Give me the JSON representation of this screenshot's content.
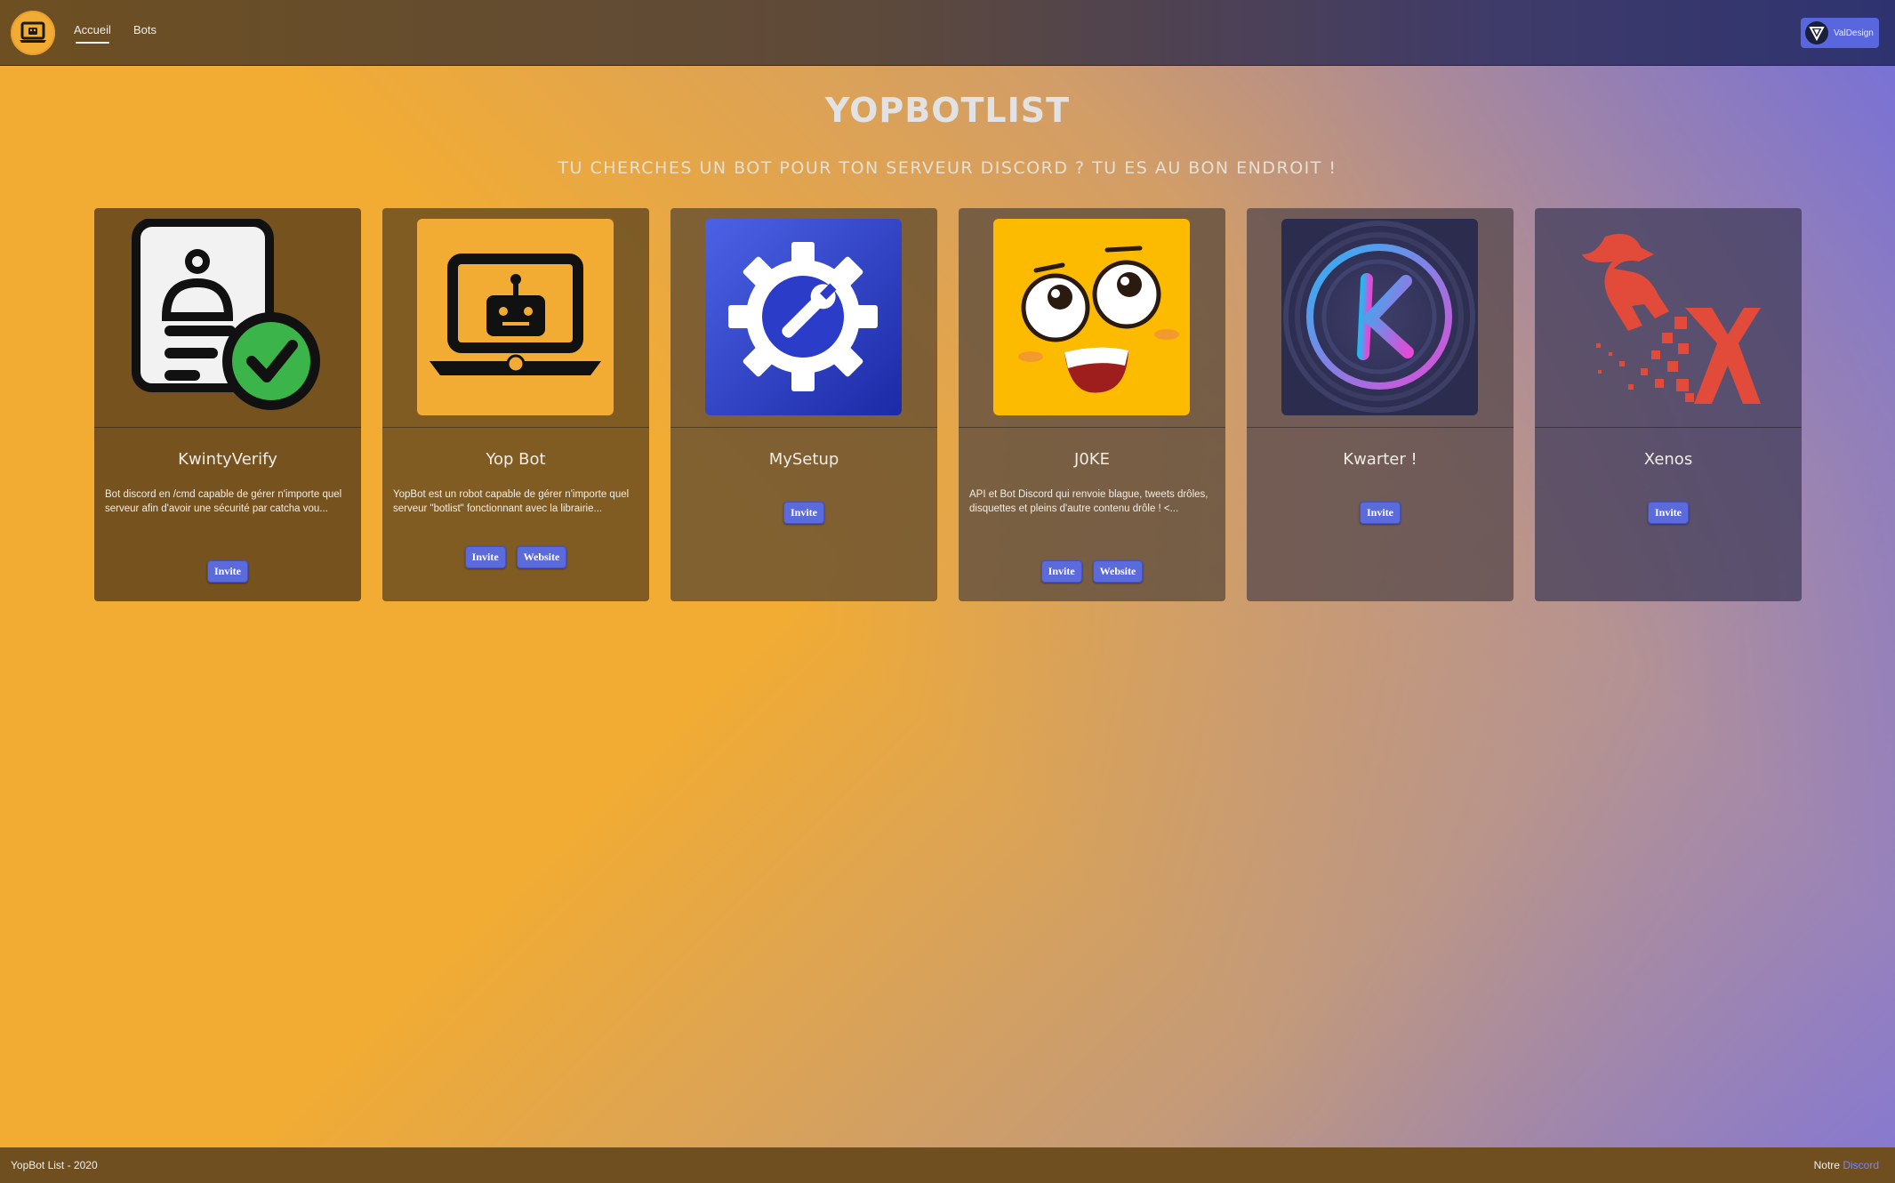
{
  "nav": {
    "links": [
      {
        "label": "Accueil",
        "active": true
      },
      {
        "label": "Bots",
        "active": false
      }
    ],
    "user_name": "ValDesign"
  },
  "hero": {
    "title": "YOPBOTLIST",
    "subtitle": "TU CHERCHES UN BOT POUR TON SERVEUR DISCORD ? TU ES AU BON ENDROIT !"
  },
  "bots": [
    {
      "name": "KwintyVerify",
      "icon": "id-card-check-icon",
      "description": "Bot discord en /cmd capable de gérer n'importe quel serveur afin d'avoir une sécurité par catcha vou...",
      "buttons": [
        "Invite"
      ],
      "card_color": "#6f4e1f"
    },
    {
      "name": "Yop Bot",
      "icon": "robot-laptop-icon",
      "description": "YopBot est un robot capable de gérer n'importe quel serveur \"botlist\" fonctionnant avec la librairie...",
      "buttons": [
        "Invite",
        "Website"
      ],
      "card_color": "#6c4e21"
    },
    {
      "name": "MySetup",
      "icon": "gear-wrench-icon",
      "description": "",
      "buttons": [
        "Invite"
      ],
      "card_color": "#5e4a3a"
    },
    {
      "name": "J0KE",
      "icon": "funny-face-icon",
      "description": "API et Bot Discord qui renvoie blague, tweets drôles, disquettes et pleins d'autre contenu drôle ! <...",
      "buttons": [
        "Invite",
        "Website"
      ],
      "card_color": "#5a4a41"
    },
    {
      "name": "Kwarter !",
      "icon": "k-circle-logo-icon",
      "description": "",
      "buttons": [
        "Invite"
      ],
      "card_color": "#4e4347"
    },
    {
      "name": "Xenos",
      "icon": "dragon-x-logo-icon",
      "description": "",
      "buttons": [
        "Invite"
      ],
      "card_color": "#433d51"
    }
  ],
  "footer": {
    "copyright": "YopBot List - 2020",
    "right_prefix": "Notre",
    "right_link": "Discord"
  },
  "colors": {
    "primary_button": "#5b6bdb",
    "page_gradient_start": "#f2ac33",
    "page_gradient_end": "#6366f1"
  }
}
